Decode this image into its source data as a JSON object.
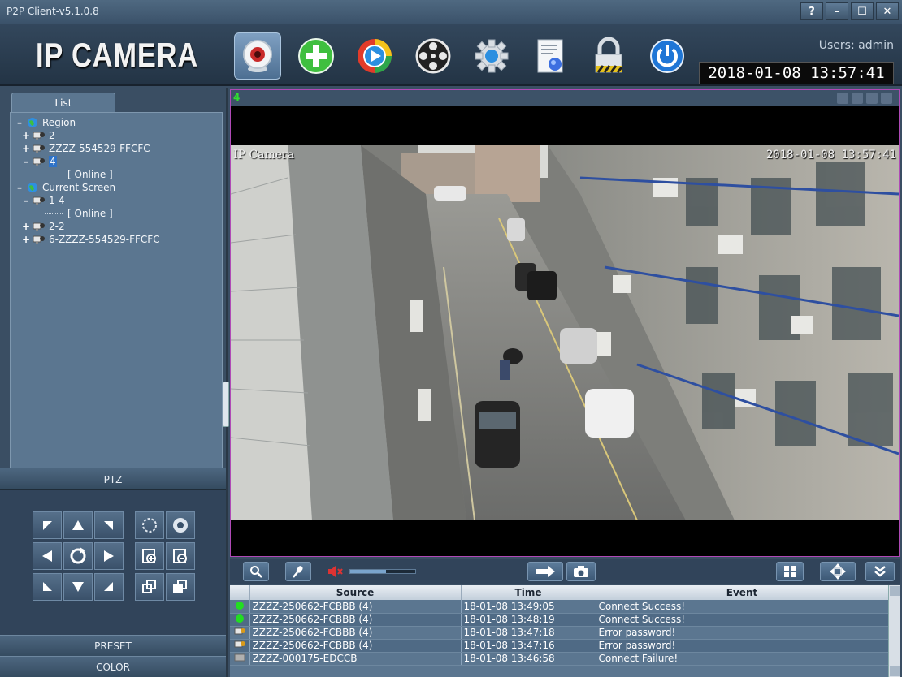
{
  "window": {
    "title": "P2P Client-v5.1.0.8",
    "controls": [
      "?",
      "–",
      "☐",
      "✕"
    ]
  },
  "header": {
    "logo": "IP CAMERA",
    "toolbar": [
      {
        "name": "live-view",
        "icon": "webcam-icon",
        "active": true
      },
      {
        "name": "add-device",
        "icon": "plus-icon"
      },
      {
        "name": "playback",
        "icon": "play-icon"
      },
      {
        "name": "ptz-control",
        "icon": "reel-icon"
      },
      {
        "name": "settings",
        "icon": "gear-icon"
      },
      {
        "name": "log",
        "icon": "document-icon"
      },
      {
        "name": "lock",
        "icon": "lock-icon"
      },
      {
        "name": "exit",
        "icon": "power-icon"
      }
    ],
    "users": "Users: admin",
    "clock": "2018-01-08  13:57:41"
  },
  "sidebar": {
    "tab": "List",
    "tree": [
      {
        "toggle": "–",
        "icon": "globe-icon",
        "label": "Region",
        "indent": 0
      },
      {
        "toggle": "+",
        "icon": "camera-icon",
        "label": "2",
        "indent": 1
      },
      {
        "toggle": "+",
        "icon": "camera-icon",
        "label": "ZZZZ-554529-FFCFC",
        "indent": 1
      },
      {
        "toggle": "–",
        "icon": "camera-icon",
        "label": "4",
        "indent": 1,
        "selected": true
      },
      {
        "toggle": "",
        "icon": "",
        "label": "[  Online  ]",
        "indent": 3
      },
      {
        "toggle": "–",
        "icon": "globe-icon",
        "label": "Current Screen",
        "indent": 0
      },
      {
        "toggle": "–",
        "icon": "camera-icon",
        "label": "1-4",
        "indent": 1
      },
      {
        "toggle": "",
        "icon": "",
        "label": "[  Online  ]",
        "indent": 3
      },
      {
        "toggle": "+",
        "icon": "camera-icon",
        "label": "2-2",
        "indent": 1
      },
      {
        "toggle": "+",
        "icon": "camera-icon",
        "label": "6-ZZZZ-554529-FFCFC",
        "indent": 1
      }
    ],
    "ptz_label": "PTZ",
    "preset_label": "PRESET",
    "color_label": "COLOR"
  },
  "video": {
    "channel": "4",
    "osd_name": "IP Camera",
    "osd_time": "2018-01-08  13:57:41"
  },
  "controls": {
    "volume_level": 0.55
  },
  "events": {
    "columns": [
      "Source",
      "Time",
      "Event"
    ],
    "rows": [
      {
        "status": "green-dot",
        "source": "ZZZZ-250662-FCBBB (4)",
        "time": "18-01-08 13:49:05",
        "event": "Connect Success!"
      },
      {
        "status": "green-dot",
        "source": "ZZZZ-250662-FCBBB (4)",
        "time": "18-01-08 13:48:19",
        "event": "Connect Success!"
      },
      {
        "status": "warning-icon",
        "source": "ZZZZ-250662-FCBBB (4)",
        "time": "18-01-08 13:47:18",
        "event": "Error password!"
      },
      {
        "status": "warning-icon",
        "source": "ZZZZ-250662-FCBBB (4)",
        "time": "18-01-08 13:47:16",
        "event": "Error password!"
      },
      {
        "status": "offline-icon",
        "source": "ZZZZ-000175-EDCCB",
        "time": "18-01-08 13:46:58",
        "event": "Connect Failure!"
      }
    ]
  }
}
